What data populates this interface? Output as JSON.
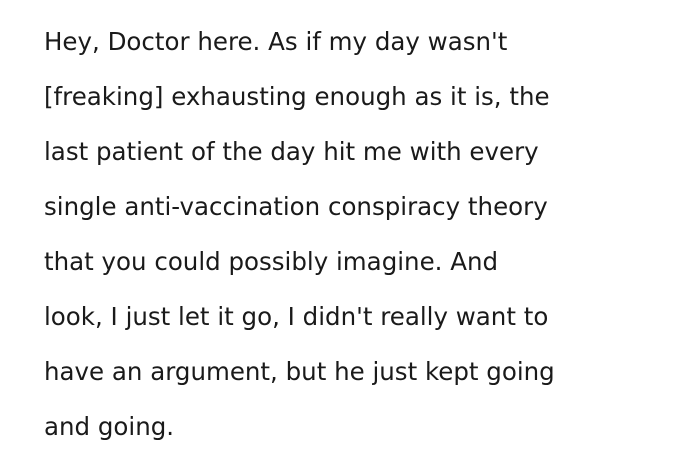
{
  "post": {
    "lines": [
      "Hey, Doctor here. As if my day wasn't",
      "[freaking] exhausting enough as it is, the",
      "last patient of the day hit me with every",
      "single anti-vaccination conspiracy theory",
      "that you could possibly imagine. And",
      "look, I just let it go, I didn't really want to",
      "have an argument, but he just kept going",
      "and going."
    ]
  }
}
